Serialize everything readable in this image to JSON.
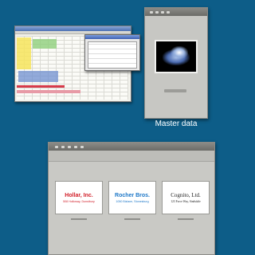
{
  "master_window": {
    "caption": "Master data"
  },
  "address_cards": [
    {
      "name": "Hollar, Inc.",
      "address": "508 Holloway, Dunstbury",
      "name_color": "#d2202a",
      "address_color": "#d2202a"
    },
    {
      "name": "Rocher Bros.",
      "address": "1050 Bizlane, Stonesburg",
      "name_color": "#1e78c8",
      "address_color": "#1e78c8"
    },
    {
      "name": "Cognito, Ltd.",
      "address": "123 Force Way, Sindsdale",
      "name_color": "#222222",
      "address_color": "#222222"
    }
  ],
  "colors": {
    "background": "#0d5d88",
    "window_gray": "#c9c9c5",
    "titlebar_gray": "#7b7b77"
  }
}
